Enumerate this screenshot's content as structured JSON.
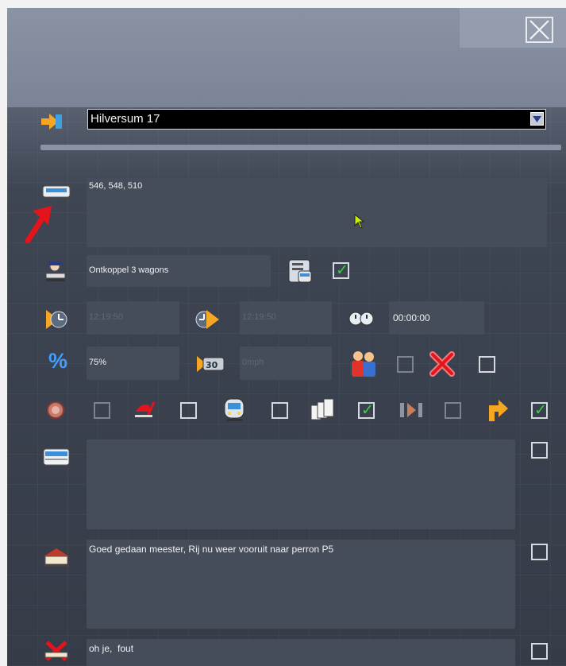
{
  "window": {
    "close_label": "×"
  },
  "destination": {
    "selected": "Hilversum 17"
  },
  "train": {
    "numbers": "546, 548, 510"
  },
  "instruction": {
    "value": "Ontkoppel 3 wagons",
    "checked": true
  },
  "times": {
    "arrival_time": "12:19:50",
    "departure_time": "12:19:50",
    "duration": "00:00:00"
  },
  "stats": {
    "percentage": "75%",
    "speed": "0mph"
  },
  "flags": [
    {
      "name": "alarm",
      "checked": false
    },
    {
      "name": "pantograph",
      "checked": false
    },
    {
      "name": "train-front",
      "checked": false
    },
    {
      "name": "documents",
      "checked": true
    },
    {
      "name": "pass-through",
      "checked": false
    },
    {
      "name": "turn-around",
      "checked": true
    }
  ],
  "messages": {
    "message_text": "",
    "station_text": "Goed gedaan meester, Rij nu weer vooruit naar perron P5",
    "fail_text": "oh je,  fout"
  },
  "colors": {
    "accent_orange": "#f5a623",
    "check_green": "#39d23a",
    "arrow_red": "#e3141b"
  }
}
